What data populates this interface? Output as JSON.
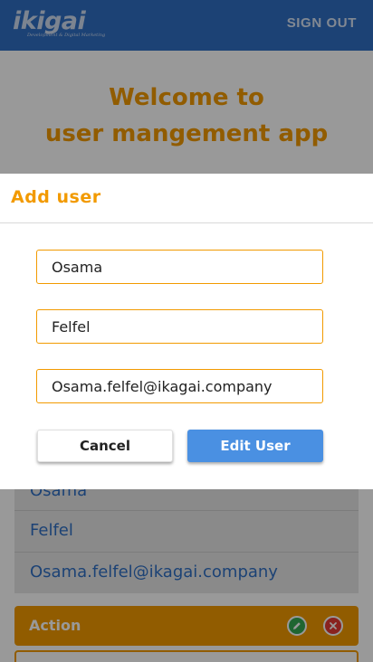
{
  "header": {
    "logo_text": "ikigai",
    "logo_tagline": "Development & Digital Marketing",
    "signout_label": "SIGN OUT"
  },
  "welcome": {
    "line1": "Welcome to",
    "line2": "user mangement app"
  },
  "user_card": {
    "first_name": "Osama",
    "last_name": "Felfel",
    "email": "Osama.felfel@ikagai.company",
    "action_label": "Action"
  },
  "dialog": {
    "title": "Add user",
    "fields": {
      "first_name": "Osama",
      "last_name": "Felfel",
      "email": "Osama.felfel@ikagai.company"
    },
    "cancel_label": "Cancel",
    "submit_label": "Edit User"
  },
  "colors": {
    "brand_blue": "#2f6fc4",
    "accent_orange": "#f29a00",
    "button_blue": "#4a90e2",
    "edit_green": "#34a853",
    "delete_red": "#e53935"
  },
  "icons": {
    "edit": "pencil-icon",
    "delete": "close-icon"
  }
}
